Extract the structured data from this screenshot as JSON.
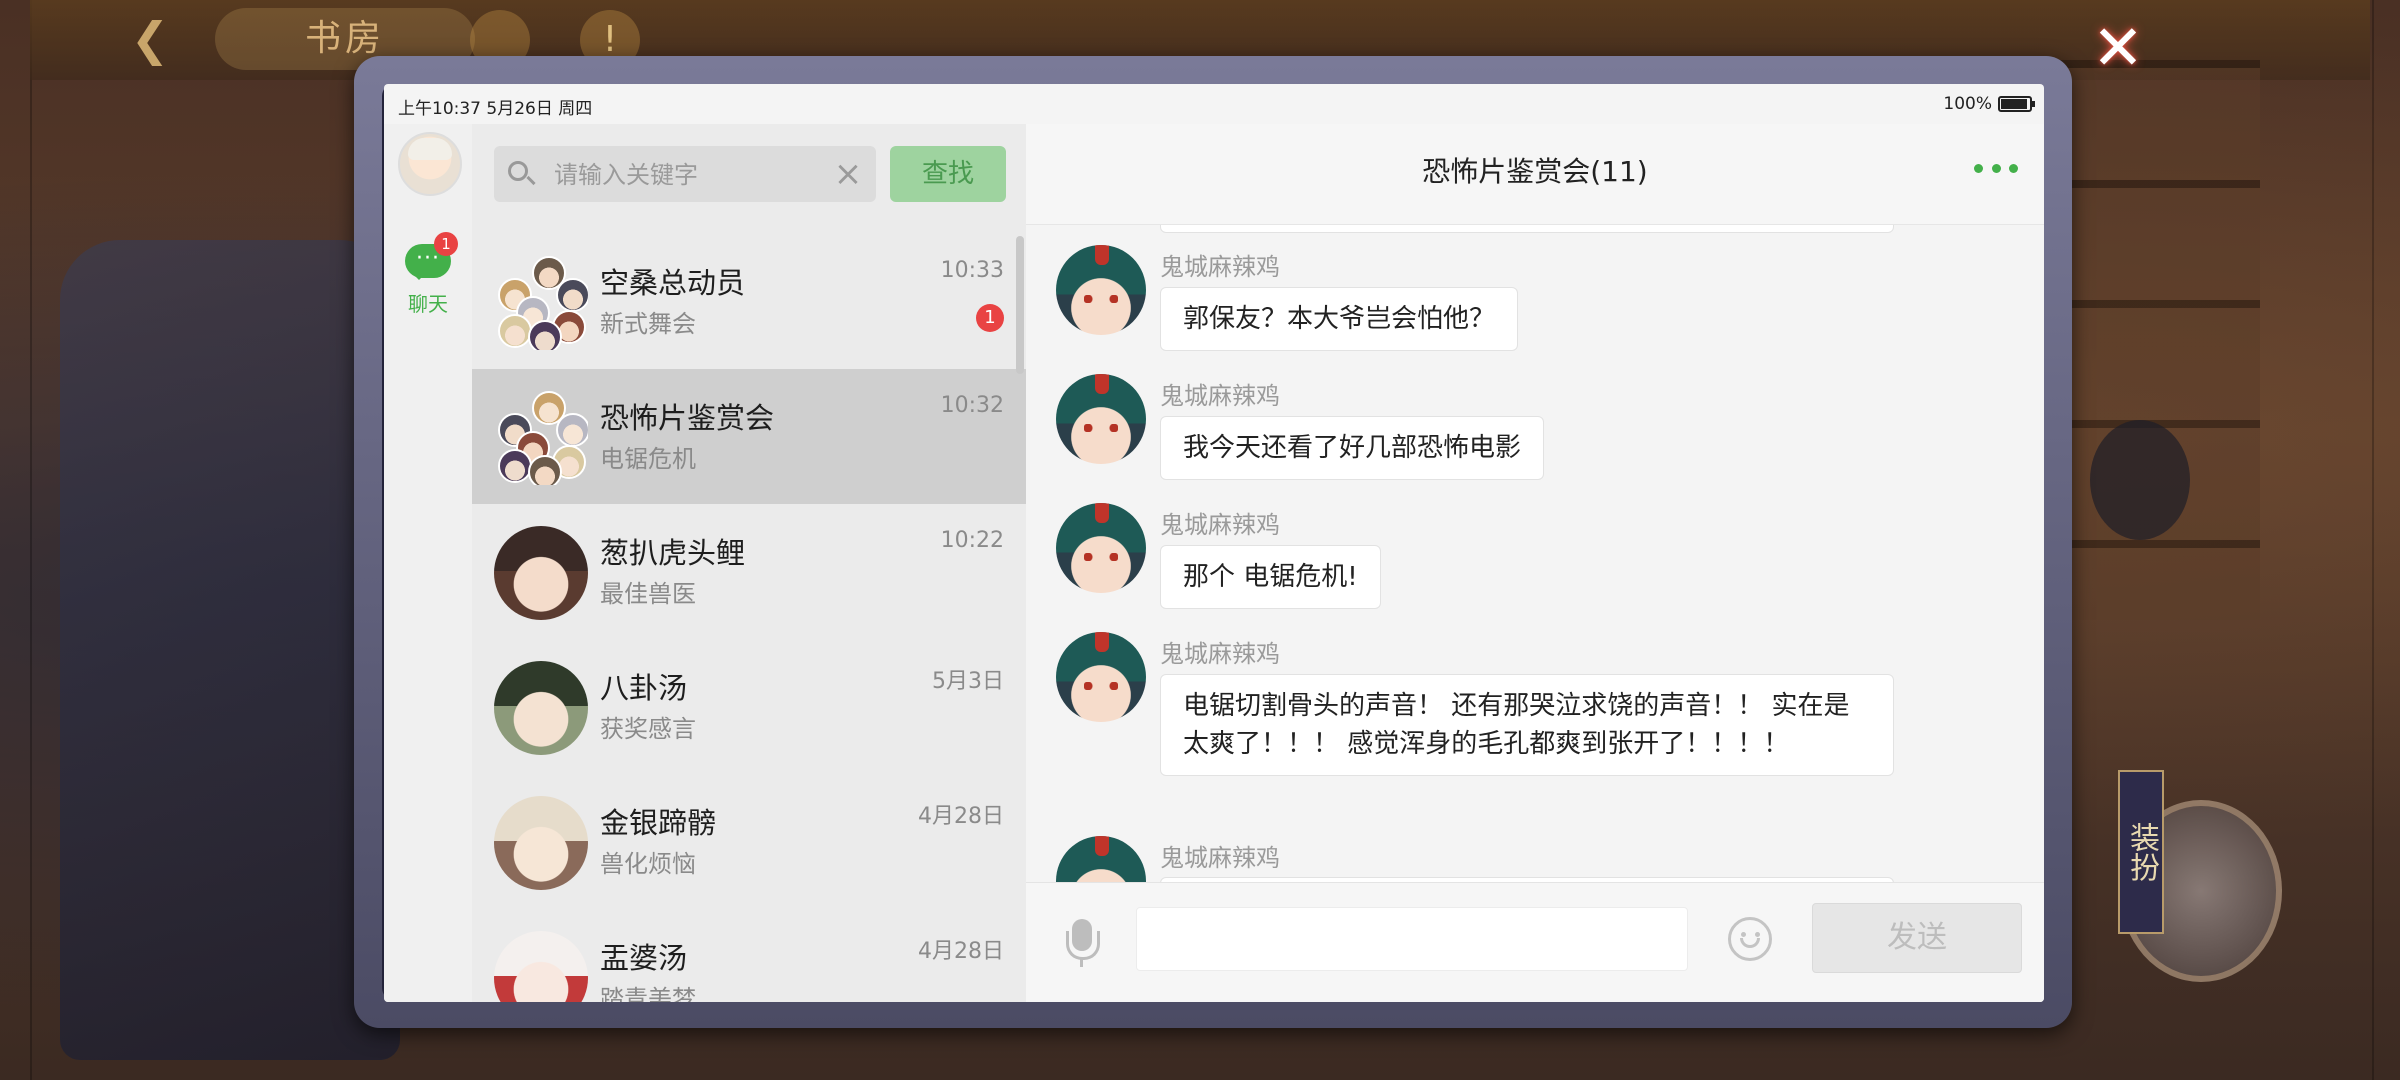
{
  "background": {
    "top_pill": "书房",
    "dress_label": "装扮"
  },
  "close_glyph": "✕",
  "status_bar": {
    "time": "上午10:37",
    "date": "5月26日",
    "weekday": "周四",
    "battery": "100%",
    "battery_level": 1.0
  },
  "nav": {
    "chat_label": "聊天",
    "chat_badge": "1"
  },
  "search": {
    "placeholder": "请输入关键字",
    "button_label": "查找"
  },
  "conversations": [
    {
      "name": "空桑总动员",
      "preview": "新式舞会",
      "time": "10:33",
      "badge": "1",
      "active": false,
      "group": true
    },
    {
      "name": "恐怖片鉴赏会",
      "preview": "电锯危机",
      "time": "10:32",
      "badge": "",
      "active": true,
      "group": true
    },
    {
      "name": "葱扒虎头鲤",
      "preview": "最佳兽医",
      "time": "10:22",
      "badge": "",
      "active": false,
      "group": false
    },
    {
      "name": "八卦汤",
      "preview": "获奖感言",
      "time": "5月3日",
      "badge": "",
      "active": false,
      "group": false
    },
    {
      "name": "金银蹄髈",
      "preview": "兽化烦恼",
      "time": "4月28日",
      "badge": "",
      "active": false,
      "group": false
    },
    {
      "name": "盂婆汤",
      "preview": "踏青美梦",
      "time": "4月28日",
      "badge": "",
      "active": false,
      "group": false
    }
  ],
  "chat": {
    "title": "恐怖片鉴赏会(11)",
    "messages": [
      {
        "sender": "鬼城麻辣鸡",
        "text": "郭保友？本大爷岂会怕他？"
      },
      {
        "sender": "鬼城麻辣鸡",
        "text": "我今天还看了好几部恐怖电影"
      },
      {
        "sender": "鬼城麻辣鸡",
        "text": "那个 电锯危机!"
      },
      {
        "sender": "鬼城麻辣鸡",
        "text": "电锯切割骨头的声音！ 还有那哭泣求饶的声音！！ 实在是太爽了！！！ 感觉浑身的毛孔都爽到张开了！！！！"
      },
      {
        "sender": "鬼城麻辣鸡",
        "text": ""
      }
    ],
    "send_label": "发送"
  }
}
